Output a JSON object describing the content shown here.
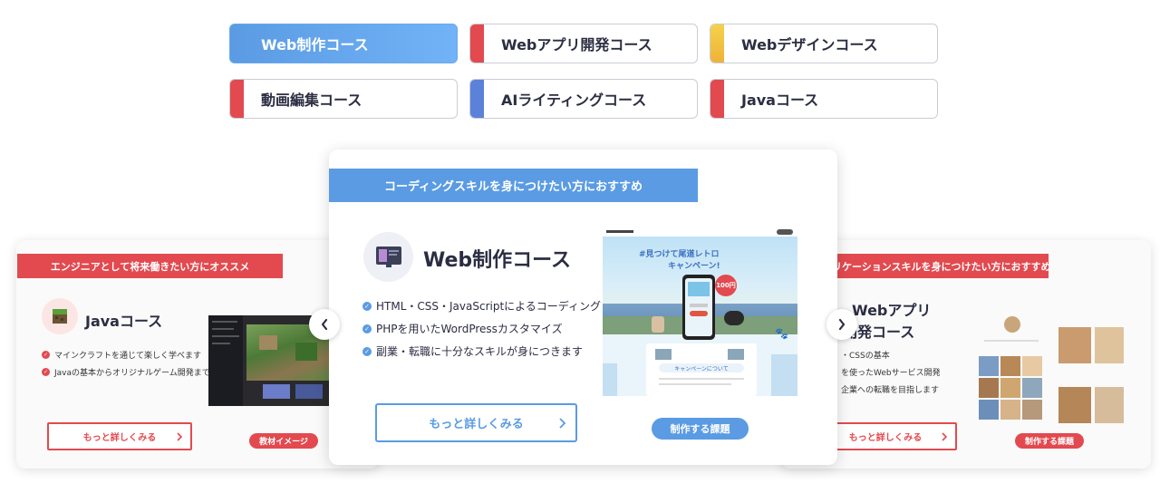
{
  "tabs": [
    {
      "label": "Web制作コース",
      "accent": "#5a9be3"
    },
    {
      "label": "Webアプリ開発コース",
      "accent": "#e24a4f"
    },
    {
      "label": "Webデザインコース",
      "accent": "#f2c744"
    },
    {
      "label": "動画編集コース",
      "accent": "#e24a4f"
    },
    {
      "label": "AIライティングコース",
      "accent": "#5b82d8"
    },
    {
      "label": "Javaコース",
      "accent": "#e24a4f"
    }
  ],
  "left_card": {
    "banner": "エンジニアとして将来働きたい方にオススメ",
    "title": "Javaコース",
    "features": [
      "マインクラフトを通じて楽しく学べます",
      "Javaの基本からオリジナルゲーム開発まで"
    ],
    "more_label": "もっと詳しくみる",
    "pill_label": "教材イメージ",
    "accent": "#e24a4f"
  },
  "main_card": {
    "banner": "コーディングスキルを身につけたい方におすすめ",
    "title": "Web制作コース",
    "features": [
      "HTML・CSS・JavaScriptによるコーディング",
      "PHPを用いたWordPressカスタマイズ",
      "副業・転職に十分なスキルが身につきます"
    ],
    "more_label": "もっと詳しくみる",
    "pill_label": "制作する課題",
    "accent": "#5a9be3",
    "preview": {
      "headline": "#見つけて尾道レトロ",
      "sub": "キャンペーン!",
      "badge": "100円",
      "info": "キャンペーンについて"
    }
  },
  "right_card": {
    "banner": "リケーションスキルを身につけたい方におすすめ",
    "title_line1": "Webアプリ",
    "title_line2": "開発コース",
    "features": [
      "・CSSの基本",
      "を使ったWebサービス開発",
      "企業への転職を目指します"
    ],
    "more_label": "もっと詳しくみる",
    "pill_label": "制作する課題",
    "accent": "#e24a4f"
  },
  "nav": {
    "prev_icon": "‹",
    "next_icon": "›"
  }
}
